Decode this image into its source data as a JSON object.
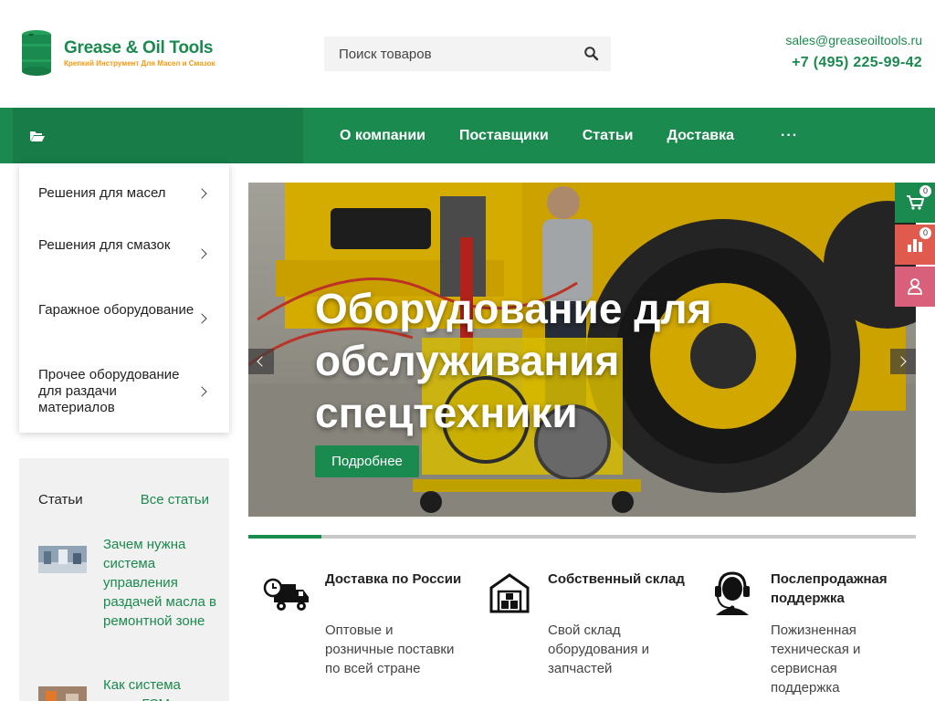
{
  "header": {
    "logo_title": "Grease & Oil Tools",
    "logo_subtitle": "Крепкий Инструмент Для Масел и Смазок",
    "search_placeholder": "Поиск товаров",
    "email": "sales@greaseoiltools.ru",
    "phone": "+7 (495) 225-99-42"
  },
  "nav": {
    "catalog_icon": "folder-open-icon",
    "items": [
      "О компании",
      "Поставщики",
      "Статьи",
      "Доставка"
    ],
    "more_label": "···"
  },
  "side_menu": {
    "items": [
      "Решения для масел",
      "Решения для смазок",
      "Гаражное оборудование",
      "Прочее оборудование для раздачи материалов"
    ]
  },
  "articles": {
    "heading": "Статьи",
    "all_label": "Все статьи",
    "items": [
      "Зачем нужна система управления раздачей масла в ремонтной зоне",
      "Как система учета ГСМ"
    ]
  },
  "banner": {
    "title": "Оборудование для обслуживания спецтехники",
    "button_label": "Подробнее",
    "slide_progress": 0.11
  },
  "features": [
    {
      "icon": "truck-icon",
      "title": "Доставка по России",
      "text": "Оптовые и розничные поставки по всей стране"
    },
    {
      "icon": "warehouse-icon",
      "title": "Собственный склад",
      "text": "Свой склад оборудования и запчастей"
    },
    {
      "icon": "support-headset-icon",
      "title": "Послепродажная поддержка",
      "text": "Пожизненная техническая и сервисная поддержка"
    }
  ],
  "floating": {
    "cart_count": "0",
    "compare_count": "0"
  },
  "colors": {
    "brand_green": "#1a8a4f",
    "brand_orange": "#f39a11",
    "compare_red": "#e05a4e",
    "account_pink": "#d9607a"
  }
}
